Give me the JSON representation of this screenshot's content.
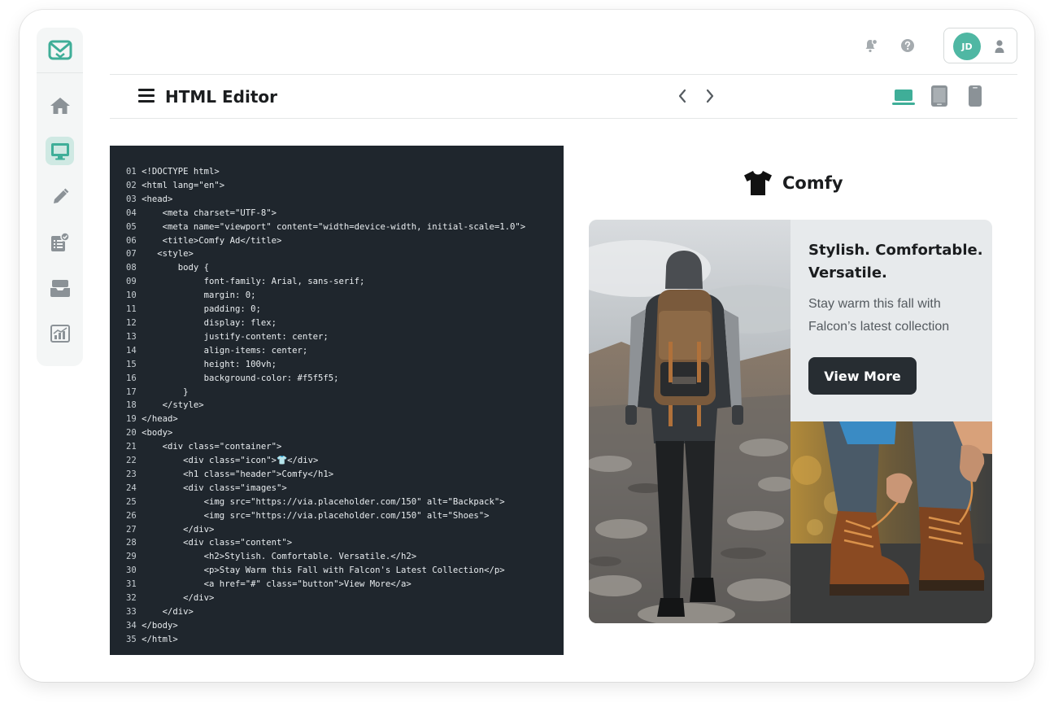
{
  "app": {
    "page_title": "HTML Editor",
    "user_initials": "JD"
  },
  "icons": {
    "logo": "mail-logo-icon",
    "nav": [
      "home-icon",
      "monitor-icon",
      "pencil-icon",
      "checklist-icon",
      "inbox-icon",
      "chart-icon"
    ],
    "topbar": [
      "notification-icon",
      "help-icon",
      "user-icon"
    ],
    "title_bar": [
      "menu-icon",
      "chevron-left-icon",
      "chevron-right-icon",
      "laptop-icon",
      "tablet-icon",
      "phone-icon"
    ]
  },
  "colors": {
    "accent": "#3fae98",
    "code_bg": "#1f262d",
    "button_bg": "#272d32"
  },
  "sidebar": {
    "active_index": 1
  },
  "code": {
    "lines": [
      "<!DOCTYPE html>",
      "<html lang=\"en\">",
      "<head>",
      "    <meta charset=\"UTF-8\">",
      "    <meta name=\"viewport\" content=\"width=device-width, initial-scale=1.0\">",
      "    <title>Comfy Ad</title>",
      "   <style>",
      "       body {",
      "            font-family: Arial, sans-serif;",
      "            margin: 0;",
      "            padding: 0;",
      "            display: flex;",
      "            justify-content: center;",
      "            align-items: center;",
      "            height: 100vh;",
      "            background-color: #f5f5f5;",
      "        }",
      "    </style>",
      "</head>",
      "<body>",
      "    <div class=\"container\">",
      "        <div class=\"icon\">👕</div>",
      "        <h1 class=\"header\">Comfy</h1>",
      "        <div class=\"images\">",
      "            <img src=\"https://via.placeholder.com/150\" alt=\"Backpack\">",
      "            <img src=\"https://via.placeholder.com/150\" alt=\"Shoes\">",
      "        </div>",
      "        <div class=\"content\">",
      "            <h2>Stylish. Comfortable. Versatile.</h2>",
      "            <p>Stay Warm this Fall with Falcon's Latest Collection</p>",
      "            <a href=\"#\" class=\"button\">View More</a>",
      "        </div>",
      "    </div>",
      "</body>",
      "</html>"
    ]
  },
  "preview": {
    "brand": "Comfy",
    "headline": "Stylish. Comfortable. Versatile.",
    "body": "Stay warm this fall with Falcon’s latest collection",
    "button": "View More"
  }
}
